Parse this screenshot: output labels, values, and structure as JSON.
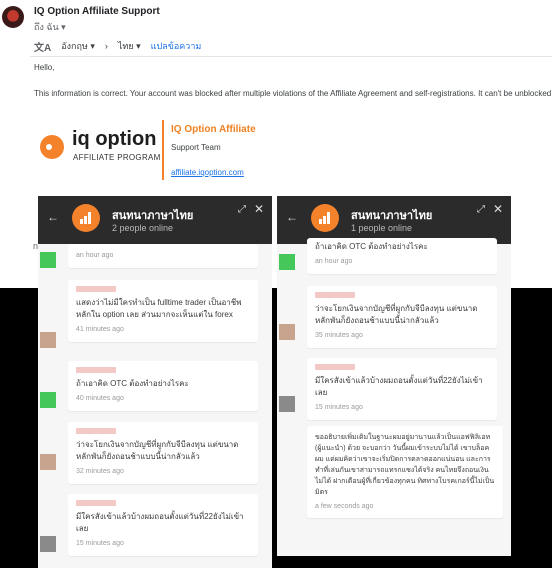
{
  "email": {
    "sender": "IQ Option Affiliate Support",
    "recipient": "ถึง ฉัน",
    "translate": {
      "from": "อังกฤษ",
      "to": "ไทย",
      "action": "แปลข้อความ"
    },
    "greeting": "Hello,",
    "message": "This information is correct. Your account was blocked after multiple violations of the Affiliate Agreement and self-registrations. It can't be unblocked."
  },
  "signature": {
    "logo_word": "iq option",
    "logo_sub": "AFFILIATE PROGRAM",
    "title": "IQ Option Affiliate",
    "team": "Support Team",
    "link": "affiliate.iqoption.com"
  },
  "colors": {
    "brand_orange": "#f4822a",
    "chat_header": "#2b2b2b",
    "link_blue": "#1a73e8"
  },
  "chat_left": {
    "room_name": "สนทนาภาษาไทย",
    "online": "2 people online",
    "messages": [
      {
        "text": "",
        "time": "an hour ago"
      },
      {
        "text": "แสดงว่าไม่มีใครทำเป็น fulltime trader เป็นอาชีพหลักใน option เลย ส่วนมากจะเห็นแต่ใน forex",
        "time": "41 minutes ago"
      },
      {
        "text": "ถ้าเอาคิด OTC ต้องทำอย่างไรคะ",
        "time": "40 minutes ago"
      },
      {
        "text": "ว่าจะโยกเงินจากบัญชีที่ผูกกับจีบีลงทุน แต่ขนาดหลักพันก็ยังถอนช้าแบบนี้น่ากลัวแล้ว",
        "time": "32 minutes ago"
      },
      {
        "text": "มีใครสังเข้าแล้วบ้างผมถอนตั้งแต่วันที่22ยังไม่เข้าเลย",
        "time": "15 minutes ago"
      }
    ]
  },
  "chat_right": {
    "room_name": "สนทนาภาษาไทย",
    "online": "1 people online",
    "messages": [
      {
        "text": "ถ้าเอาคิด OTC ต้องทำอย่างไรคะ",
        "time": "an hour ago"
      },
      {
        "text": "ว่าจะโยกเงินจากบัญชีที่ผูกกับจีบีลงทุน แต่ขนาดหลักพันก็ยังถอนช้าแบบนี้น่ากลัวแล้ว",
        "time": "35 minutes ago"
      },
      {
        "text": "มีใครสังเข้าแล้วบ้างผมถอนตั้งแต่วันที่22ยังไม่เข้าเลย",
        "time": "15 minutes ago"
      },
      {
        "text": "ขออธิบายเพิ่มเติมในฐานะผมอยู่มานานแล้วเป็นแอฟฟิลิเอท (ผู้แนะนำ) ด้วย จะบอกว่า วันนี้ผมเข้าระบบไม่ได้ เขาบล็อคผม แต่ผมคิดว่าเขาจะเริ่มปิดการตลาดออกแน่นอน และการทำที่เล่นกันเขาสามารถแทรกแซงได้จริง คนไทยจึงถอนเงินไม่ได้ ฝากเตือนผู้ที่เกี่ยวข้องทุกคน ทิศทางโบรคเกอร์นี้ไม่เป็นมิตร",
        "time": "a few seconds ago"
      }
    ]
  }
}
